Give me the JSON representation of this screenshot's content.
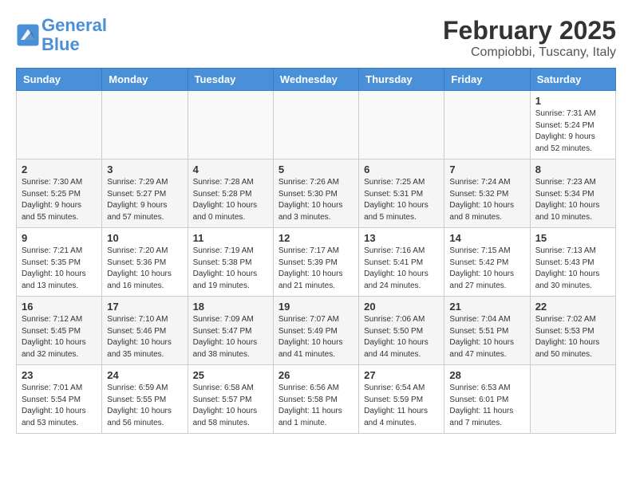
{
  "header": {
    "logo_line1": "General",
    "logo_line2": "Blue",
    "month_title": "February 2025",
    "location": "Compiobbi, Tuscany, Italy"
  },
  "days_of_week": [
    "Sunday",
    "Monday",
    "Tuesday",
    "Wednesday",
    "Thursday",
    "Friday",
    "Saturday"
  ],
  "weeks": [
    [
      {
        "day": "",
        "info": ""
      },
      {
        "day": "",
        "info": ""
      },
      {
        "day": "",
        "info": ""
      },
      {
        "day": "",
        "info": ""
      },
      {
        "day": "",
        "info": ""
      },
      {
        "day": "",
        "info": ""
      },
      {
        "day": "1",
        "info": "Sunrise: 7:31 AM\nSunset: 5:24 PM\nDaylight: 9 hours and 52 minutes."
      }
    ],
    [
      {
        "day": "2",
        "info": "Sunrise: 7:30 AM\nSunset: 5:25 PM\nDaylight: 9 hours and 55 minutes."
      },
      {
        "day": "3",
        "info": "Sunrise: 7:29 AM\nSunset: 5:27 PM\nDaylight: 9 hours and 57 minutes."
      },
      {
        "day": "4",
        "info": "Sunrise: 7:28 AM\nSunset: 5:28 PM\nDaylight: 10 hours and 0 minutes."
      },
      {
        "day": "5",
        "info": "Sunrise: 7:26 AM\nSunset: 5:30 PM\nDaylight: 10 hours and 3 minutes."
      },
      {
        "day": "6",
        "info": "Sunrise: 7:25 AM\nSunset: 5:31 PM\nDaylight: 10 hours and 5 minutes."
      },
      {
        "day": "7",
        "info": "Sunrise: 7:24 AM\nSunset: 5:32 PM\nDaylight: 10 hours and 8 minutes."
      },
      {
        "day": "8",
        "info": "Sunrise: 7:23 AM\nSunset: 5:34 PM\nDaylight: 10 hours and 10 minutes."
      }
    ],
    [
      {
        "day": "9",
        "info": "Sunrise: 7:21 AM\nSunset: 5:35 PM\nDaylight: 10 hours and 13 minutes."
      },
      {
        "day": "10",
        "info": "Sunrise: 7:20 AM\nSunset: 5:36 PM\nDaylight: 10 hours and 16 minutes."
      },
      {
        "day": "11",
        "info": "Sunrise: 7:19 AM\nSunset: 5:38 PM\nDaylight: 10 hours and 19 minutes."
      },
      {
        "day": "12",
        "info": "Sunrise: 7:17 AM\nSunset: 5:39 PM\nDaylight: 10 hours and 21 minutes."
      },
      {
        "day": "13",
        "info": "Sunrise: 7:16 AM\nSunset: 5:41 PM\nDaylight: 10 hours and 24 minutes."
      },
      {
        "day": "14",
        "info": "Sunrise: 7:15 AM\nSunset: 5:42 PM\nDaylight: 10 hours and 27 minutes."
      },
      {
        "day": "15",
        "info": "Sunrise: 7:13 AM\nSunset: 5:43 PM\nDaylight: 10 hours and 30 minutes."
      }
    ],
    [
      {
        "day": "16",
        "info": "Sunrise: 7:12 AM\nSunset: 5:45 PM\nDaylight: 10 hours and 32 minutes."
      },
      {
        "day": "17",
        "info": "Sunrise: 7:10 AM\nSunset: 5:46 PM\nDaylight: 10 hours and 35 minutes."
      },
      {
        "day": "18",
        "info": "Sunrise: 7:09 AM\nSunset: 5:47 PM\nDaylight: 10 hours and 38 minutes."
      },
      {
        "day": "19",
        "info": "Sunrise: 7:07 AM\nSunset: 5:49 PM\nDaylight: 10 hours and 41 minutes."
      },
      {
        "day": "20",
        "info": "Sunrise: 7:06 AM\nSunset: 5:50 PM\nDaylight: 10 hours and 44 minutes."
      },
      {
        "day": "21",
        "info": "Sunrise: 7:04 AM\nSunset: 5:51 PM\nDaylight: 10 hours and 47 minutes."
      },
      {
        "day": "22",
        "info": "Sunrise: 7:02 AM\nSunset: 5:53 PM\nDaylight: 10 hours and 50 minutes."
      }
    ],
    [
      {
        "day": "23",
        "info": "Sunrise: 7:01 AM\nSunset: 5:54 PM\nDaylight: 10 hours and 53 minutes."
      },
      {
        "day": "24",
        "info": "Sunrise: 6:59 AM\nSunset: 5:55 PM\nDaylight: 10 hours and 56 minutes."
      },
      {
        "day": "25",
        "info": "Sunrise: 6:58 AM\nSunset: 5:57 PM\nDaylight: 10 hours and 58 minutes."
      },
      {
        "day": "26",
        "info": "Sunrise: 6:56 AM\nSunset: 5:58 PM\nDaylight: 11 hours and 1 minute."
      },
      {
        "day": "27",
        "info": "Sunrise: 6:54 AM\nSunset: 5:59 PM\nDaylight: 11 hours and 4 minutes."
      },
      {
        "day": "28",
        "info": "Sunrise: 6:53 AM\nSunset: 6:01 PM\nDaylight: 11 hours and 7 minutes."
      },
      {
        "day": "",
        "info": ""
      }
    ]
  ]
}
